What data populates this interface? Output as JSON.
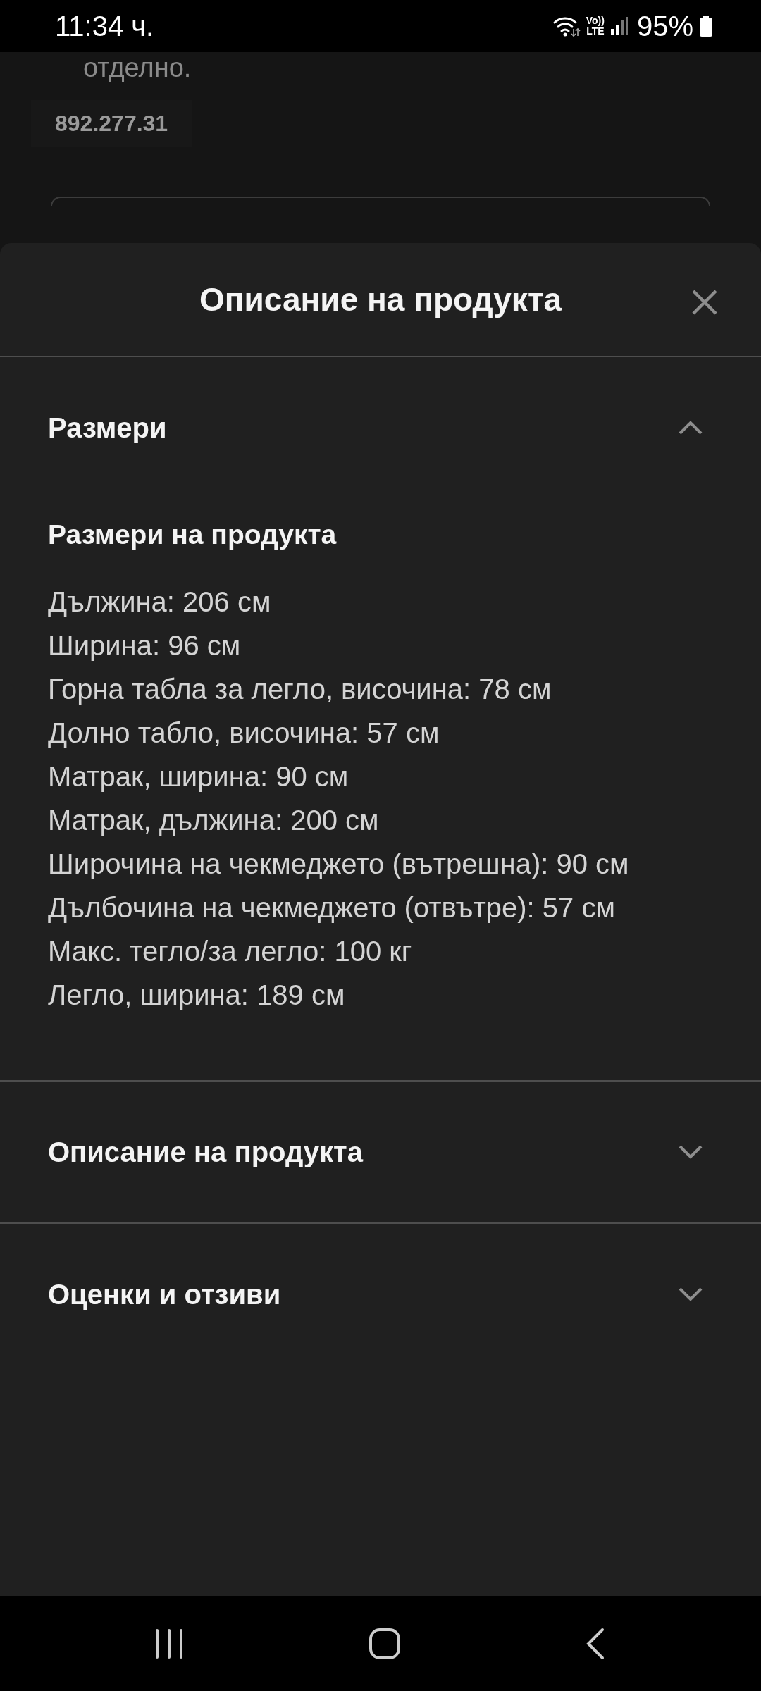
{
  "status_bar": {
    "time": "11:34 ч.",
    "network_top": "Vo))",
    "network_bottom": "LTE",
    "battery": "95%"
  },
  "background_page": {
    "text": "отделно.",
    "article_number": "892.277.31"
  },
  "sheet": {
    "title": "Описание на продукта",
    "sections": [
      {
        "title": "Размери",
        "expanded": true,
        "subheading": "Размери на продукта",
        "lines": [
          "Дължина: 206 см",
          "Ширина: 96 см",
          "Горна табла за легло, височина: 78 см",
          "Долно табло, височина: 57 см",
          "Матрак, ширина: 90 см",
          "Матрак, дължина: 200 см",
          "Широчина на чекмеджето (вътрешна): 90 см",
          "Дълбочина на чекмеджето (отвътре): 57 см",
          "Макс. тегло/за легло: 100 кг",
          "Легло, ширина: 189 см"
        ]
      },
      {
        "title": "Описание на продукта",
        "expanded": false
      },
      {
        "title": "Оценки и отзиви",
        "expanded": false
      }
    ]
  }
}
